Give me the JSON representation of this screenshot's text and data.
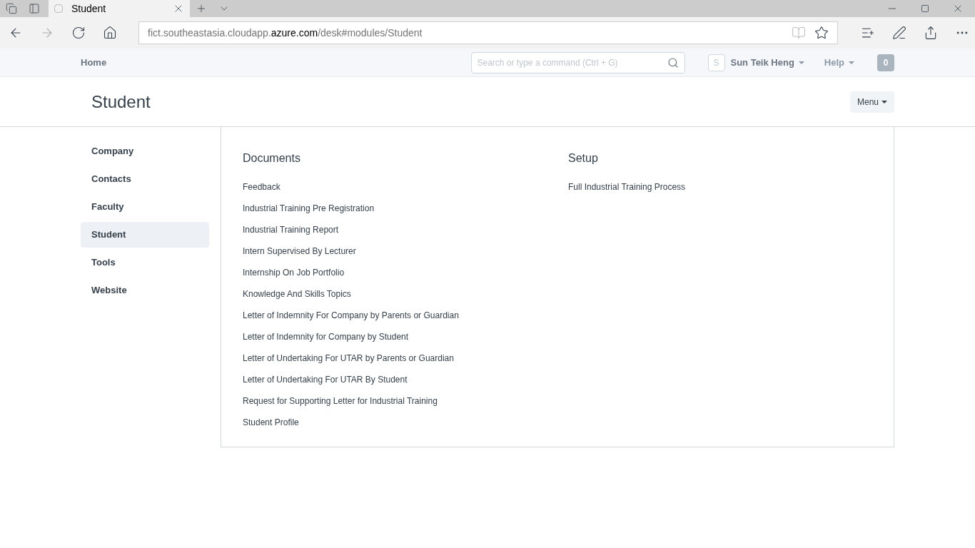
{
  "browser": {
    "tab": {
      "title": "Student"
    },
    "url": {
      "prefix": "fict.southeastasia.cloudapp.",
      "domain": "azure.com",
      "suffix": "/desk#modules/Student"
    }
  },
  "navbar": {
    "home": "Home",
    "search": {
      "placeholder": "Search or type a command (Ctrl + G)"
    },
    "user": {
      "avatar": "S",
      "name": "Sun Teik Heng"
    },
    "help": "Help",
    "notifications": "0"
  },
  "page": {
    "title": "Student",
    "menu": "Menu"
  },
  "sidebar": {
    "items": [
      {
        "label": "Company",
        "selected": false
      },
      {
        "label": "Contacts",
        "selected": false
      },
      {
        "label": "Faculty",
        "selected": false
      },
      {
        "label": "Student",
        "selected": true
      },
      {
        "label": "Tools",
        "selected": false
      },
      {
        "label": "Website",
        "selected": false
      }
    ]
  },
  "sections": [
    {
      "title": "Documents",
      "links": [
        "Feedback",
        "Industrial Training Pre Registration",
        "Industrial Training Report",
        "Intern Supervised By Lecturer",
        "Internship On Job Portfolio",
        "Knowledge And Skills Topics",
        "Letter of Indemnity For Company by Parents or Guardian",
        "Letter of Indemnity for Company by Student",
        "Letter of Undertaking For UTAR by Parents or Guardian",
        "Letter of Undertaking For UTAR By Student",
        "Request for Supporting Letter for Industrial Training",
        "Student Profile"
      ]
    },
    {
      "title": "Setup",
      "links": [
        "Full Industrial Training Process"
      ]
    }
  ]
}
